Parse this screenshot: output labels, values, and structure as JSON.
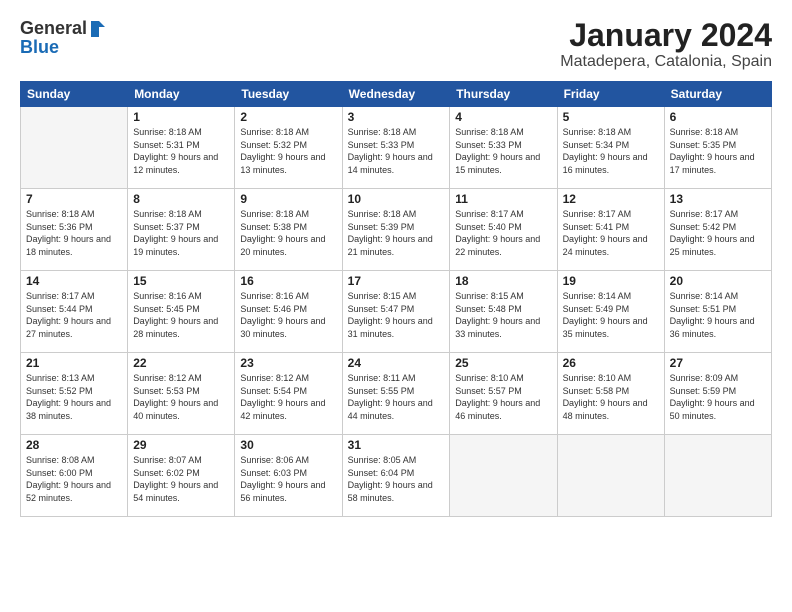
{
  "header": {
    "logo_general": "General",
    "logo_blue": "Blue",
    "main_title": "January 2024",
    "subtitle": "Matadepera, Catalonia, Spain"
  },
  "weekdays": [
    "Sunday",
    "Monday",
    "Tuesday",
    "Wednesday",
    "Thursday",
    "Friday",
    "Saturday"
  ],
  "weeks": [
    [
      {
        "day": "",
        "sunrise": "",
        "sunset": "",
        "daylight": ""
      },
      {
        "day": "1",
        "sunrise": "Sunrise: 8:18 AM",
        "sunset": "Sunset: 5:31 PM",
        "daylight": "Daylight: 9 hours and 12 minutes."
      },
      {
        "day": "2",
        "sunrise": "Sunrise: 8:18 AM",
        "sunset": "Sunset: 5:32 PM",
        "daylight": "Daylight: 9 hours and 13 minutes."
      },
      {
        "day": "3",
        "sunrise": "Sunrise: 8:18 AM",
        "sunset": "Sunset: 5:33 PM",
        "daylight": "Daylight: 9 hours and 14 minutes."
      },
      {
        "day": "4",
        "sunrise": "Sunrise: 8:18 AM",
        "sunset": "Sunset: 5:33 PM",
        "daylight": "Daylight: 9 hours and 15 minutes."
      },
      {
        "day": "5",
        "sunrise": "Sunrise: 8:18 AM",
        "sunset": "Sunset: 5:34 PM",
        "daylight": "Daylight: 9 hours and 16 minutes."
      },
      {
        "day": "6",
        "sunrise": "Sunrise: 8:18 AM",
        "sunset": "Sunset: 5:35 PM",
        "daylight": "Daylight: 9 hours and 17 minutes."
      }
    ],
    [
      {
        "day": "7",
        "sunrise": "Sunrise: 8:18 AM",
        "sunset": "Sunset: 5:36 PM",
        "daylight": "Daylight: 9 hours and 18 minutes."
      },
      {
        "day": "8",
        "sunrise": "Sunrise: 8:18 AM",
        "sunset": "Sunset: 5:37 PM",
        "daylight": "Daylight: 9 hours and 19 minutes."
      },
      {
        "day": "9",
        "sunrise": "Sunrise: 8:18 AM",
        "sunset": "Sunset: 5:38 PM",
        "daylight": "Daylight: 9 hours and 20 minutes."
      },
      {
        "day": "10",
        "sunrise": "Sunrise: 8:18 AM",
        "sunset": "Sunset: 5:39 PM",
        "daylight": "Daylight: 9 hours and 21 minutes."
      },
      {
        "day": "11",
        "sunrise": "Sunrise: 8:17 AM",
        "sunset": "Sunset: 5:40 PM",
        "daylight": "Daylight: 9 hours and 22 minutes."
      },
      {
        "day": "12",
        "sunrise": "Sunrise: 8:17 AM",
        "sunset": "Sunset: 5:41 PM",
        "daylight": "Daylight: 9 hours and 24 minutes."
      },
      {
        "day": "13",
        "sunrise": "Sunrise: 8:17 AM",
        "sunset": "Sunset: 5:42 PM",
        "daylight": "Daylight: 9 hours and 25 minutes."
      }
    ],
    [
      {
        "day": "14",
        "sunrise": "Sunrise: 8:17 AM",
        "sunset": "Sunset: 5:44 PM",
        "daylight": "Daylight: 9 hours and 27 minutes."
      },
      {
        "day": "15",
        "sunrise": "Sunrise: 8:16 AM",
        "sunset": "Sunset: 5:45 PM",
        "daylight": "Daylight: 9 hours and 28 minutes."
      },
      {
        "day": "16",
        "sunrise": "Sunrise: 8:16 AM",
        "sunset": "Sunset: 5:46 PM",
        "daylight": "Daylight: 9 hours and 30 minutes."
      },
      {
        "day": "17",
        "sunrise": "Sunrise: 8:15 AM",
        "sunset": "Sunset: 5:47 PM",
        "daylight": "Daylight: 9 hours and 31 minutes."
      },
      {
        "day": "18",
        "sunrise": "Sunrise: 8:15 AM",
        "sunset": "Sunset: 5:48 PM",
        "daylight": "Daylight: 9 hours and 33 minutes."
      },
      {
        "day": "19",
        "sunrise": "Sunrise: 8:14 AM",
        "sunset": "Sunset: 5:49 PM",
        "daylight": "Daylight: 9 hours and 35 minutes."
      },
      {
        "day": "20",
        "sunrise": "Sunrise: 8:14 AM",
        "sunset": "Sunset: 5:51 PM",
        "daylight": "Daylight: 9 hours and 36 minutes."
      }
    ],
    [
      {
        "day": "21",
        "sunrise": "Sunrise: 8:13 AM",
        "sunset": "Sunset: 5:52 PM",
        "daylight": "Daylight: 9 hours and 38 minutes."
      },
      {
        "day": "22",
        "sunrise": "Sunrise: 8:12 AM",
        "sunset": "Sunset: 5:53 PM",
        "daylight": "Daylight: 9 hours and 40 minutes."
      },
      {
        "day": "23",
        "sunrise": "Sunrise: 8:12 AM",
        "sunset": "Sunset: 5:54 PM",
        "daylight": "Daylight: 9 hours and 42 minutes."
      },
      {
        "day": "24",
        "sunrise": "Sunrise: 8:11 AM",
        "sunset": "Sunset: 5:55 PM",
        "daylight": "Daylight: 9 hours and 44 minutes."
      },
      {
        "day": "25",
        "sunrise": "Sunrise: 8:10 AM",
        "sunset": "Sunset: 5:57 PM",
        "daylight": "Daylight: 9 hours and 46 minutes."
      },
      {
        "day": "26",
        "sunrise": "Sunrise: 8:10 AM",
        "sunset": "Sunset: 5:58 PM",
        "daylight": "Daylight: 9 hours and 48 minutes."
      },
      {
        "day": "27",
        "sunrise": "Sunrise: 8:09 AM",
        "sunset": "Sunset: 5:59 PM",
        "daylight": "Daylight: 9 hours and 50 minutes."
      }
    ],
    [
      {
        "day": "28",
        "sunrise": "Sunrise: 8:08 AM",
        "sunset": "Sunset: 6:00 PM",
        "daylight": "Daylight: 9 hours and 52 minutes."
      },
      {
        "day": "29",
        "sunrise": "Sunrise: 8:07 AM",
        "sunset": "Sunset: 6:02 PM",
        "daylight": "Daylight: 9 hours and 54 minutes."
      },
      {
        "day": "30",
        "sunrise": "Sunrise: 8:06 AM",
        "sunset": "Sunset: 6:03 PM",
        "daylight": "Daylight: 9 hours and 56 minutes."
      },
      {
        "day": "31",
        "sunrise": "Sunrise: 8:05 AM",
        "sunset": "Sunset: 6:04 PM",
        "daylight": "Daylight: 9 hours and 58 minutes."
      },
      {
        "day": "",
        "sunrise": "",
        "sunset": "",
        "daylight": ""
      },
      {
        "day": "",
        "sunrise": "",
        "sunset": "",
        "daylight": ""
      },
      {
        "day": "",
        "sunrise": "",
        "sunset": "",
        "daylight": ""
      }
    ]
  ]
}
